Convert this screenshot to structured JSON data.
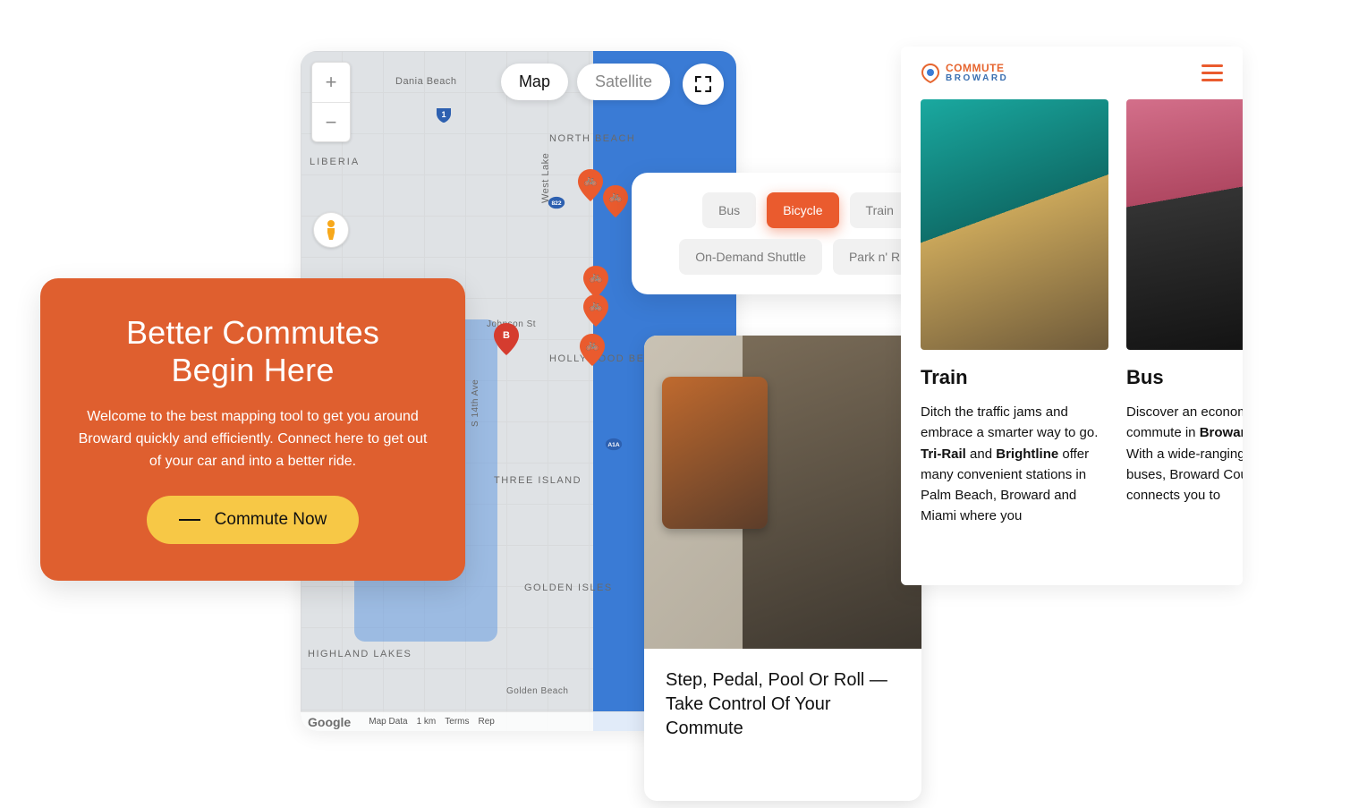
{
  "hero": {
    "title_line1": "Better Commutes",
    "title_line2": "Begin Here",
    "body": "Welcome to the best mapping tool to get you around Broward quickly and efficiently. Connect here to get out of your car and into a better ride.",
    "cta_label": "Commute Now"
  },
  "map": {
    "type_tabs": {
      "map": "Map",
      "satellite": "Satellite",
      "active": "map"
    },
    "zoom": {
      "in": "+",
      "out": "−"
    },
    "labels": {
      "dania_beach": "Dania Beach",
      "liberia": "LIBERIA",
      "north_beach": "NORTH BEACH",
      "hollywood_beach": "HOLLYWOOD BEACH",
      "three_island": "THREE ISLAND",
      "golden_isles": "GOLDEN ISLES",
      "highland_lakes": "HIGHLAND LAKES",
      "west_lake": "West Lake",
      "johnson_st": "Johnson St",
      "s14": "S 14th Ave",
      "golden_beach": "Golden Beach"
    },
    "shields": {
      "a1a": "A1A",
      "h1": "1",
      "r822": "822"
    },
    "pin_red_letter": "B",
    "credits": {
      "logo": "Google",
      "data": "Map Data",
      "scale": "1 km",
      "terms": "Terms",
      "report": "Rep"
    }
  },
  "filters": {
    "items": [
      "Bus",
      "Bicycle",
      "Train",
      "On-Demand Shuttle",
      "Park n' Ride"
    ],
    "active_index": 1
  },
  "content": {
    "title": "Step, Pedal, Pool Or Roll — Take Control Of Your Commute"
  },
  "mobile": {
    "brand": {
      "line1": "COMMUTE",
      "line2": "BROWARD"
    },
    "cards": [
      {
        "kind": "train",
        "title": "Train",
        "desc_pre": "Ditch the traffic jams and embrace a smarter way to go. ",
        "bold1": "Tri-Rail",
        "mid": " and ",
        "bold2": "Brightline",
        "desc_post": " offer many convenient stations in Palm Beach, Broward and Miami where you"
      },
      {
        "kind": "bus",
        "title": "Bus",
        "desc_pre": "Discover an economical way to commute in ",
        "bold1": "Broward County",
        "mid": ". ",
        "bold2": "",
        "desc_post": "With a wide-ranging network of buses, Broward County connects you to"
      }
    ]
  }
}
